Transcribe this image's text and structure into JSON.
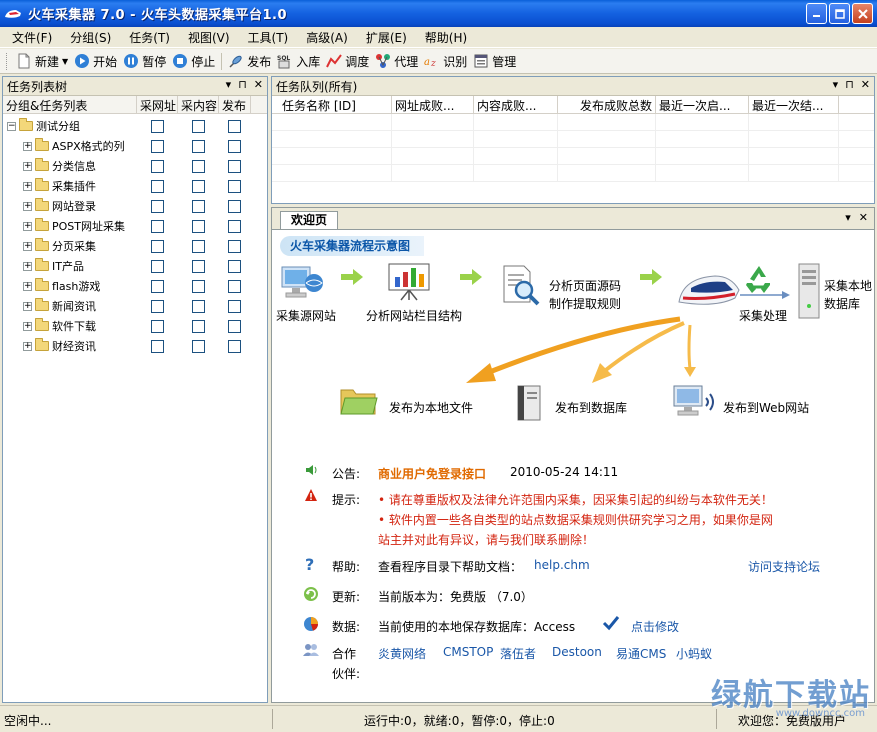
{
  "window": {
    "title": "火车采集器 7.0 - 火车头数据采集平台1.0"
  },
  "menu": [
    "文件(F)",
    "分组(S)",
    "任务(T)",
    "视图(V)",
    "工具(T)",
    "高级(A)",
    "扩展(E)",
    "帮助(H)"
  ],
  "toolbar": {
    "new": "新建",
    "start": "开始",
    "pause": "暂停",
    "stop": "停止",
    "publish": "发布",
    "import": "入库",
    "schedule": "调度",
    "proxy": "代理",
    "recognize": "识别",
    "manage": "管理"
  },
  "left_panel": {
    "title": "任务列表树",
    "columns": [
      "分组&任务列表",
      "采网址",
      "采内容",
      "发布"
    ],
    "root": "测试分组",
    "items": [
      "ASPX格式的列",
      "分类信息",
      "采集插件",
      "网站登录",
      "POST网址采集",
      "分页采集",
      "IT产品",
      "flash游戏",
      "新闻资讯",
      "软件下载",
      "财经资讯"
    ]
  },
  "queue_panel": {
    "title": "任务队列(所有)",
    "columns": [
      "任务名称 [ID]",
      "网址成败...",
      "内容成败...",
      "发布成败总数",
      "最近一次启...",
      "最近一次结..."
    ]
  },
  "welcome": {
    "tab": "欢迎页",
    "flow_title": "火车采集器流程示意图",
    "steps": {
      "collect_source": "采集源网站",
      "analyze_structure": "分析网站栏目结构",
      "analyze_source_1": "分析页面源码",
      "analyze_source_2": "制作提取规则",
      "process": "采集处理",
      "local_db_1": "采集本地",
      "local_db_2": "数据库",
      "pub_file": "发布为本地文件",
      "pub_db": "发布到数据库",
      "pub_web": "发布到Web网站"
    },
    "notice_label": "公告:",
    "notice_title": "商业用户免登录接口",
    "notice_date": "2010-05-24 14:11",
    "tip_label": "提示:",
    "tip_1": "• 请在尊重版权及法律允许范围内采集，因采集引起的纠纷与本软件无关！",
    "tip_2a": "• 软件内置一些各自类型的站点数据采集规则供研究学习之用，如果你是网",
    "tip_2b": "站主并对此有异议，请与我们联系删除！",
    "help_label": "帮助:",
    "help_text": "查看程序目录下帮助文档：",
    "help_file": "help.chm",
    "forum_link": "访问支持论坛",
    "update_label": "更新:",
    "update_text": "当前版本为：免费版 （7.0）",
    "data_label": "数据:",
    "data_text": "当前使用的本地保存数据库：Access",
    "data_link": "点击修改",
    "partner_label_1": "合作",
    "partner_label_2": "伙伴:",
    "partners": [
      "炎黄网络",
      "CMSTOP",
      "落伍者",
      "Destoon",
      "易通CMS",
      "小蚂蚁"
    ]
  },
  "status": {
    "left": "空闲中...",
    "counts": "运行中:0，就绪:0，暂停:0，停止:0",
    "right": "欢迎您：免费版用户"
  },
  "watermark": {
    "text": "绿航下载站",
    "sub": "www.downcc.com"
  },
  "colors": {
    "title_blue": "#0a5fd8",
    "notice_orange": "#e06a00",
    "tip_red": "#d32410",
    "link_blue": "#1a57a8"
  }
}
